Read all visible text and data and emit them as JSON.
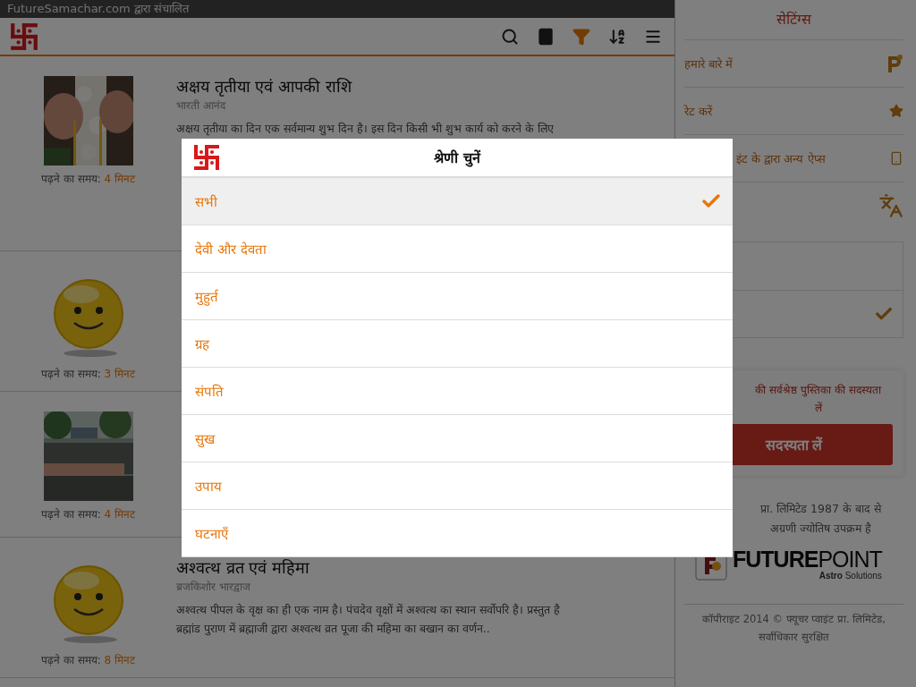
{
  "top_strip": {
    "text": "FutureSamachar.com द्वारा संचालित"
  },
  "toolbar": {
    "buttons": [
      {
        "kind": "search",
        "selected": false
      },
      {
        "kind": "book",
        "selected": false
      },
      {
        "kind": "filter",
        "selected": true
      },
      {
        "kind": "sort",
        "selected": false
      },
      {
        "kind": "menu",
        "selected": false
      }
    ]
  },
  "articles": [
    {
      "kind": "picture",
      "title": "अक्षय तृतीया एवं आपकी राशि",
      "author": "भारती आनंद",
      "body_lines": [
        "अक्षय तृतीया का दिन एक सर्वमान्य  शुभ दिन है। इस दिन किसी भी शुभ  कार्य को करने के लिए"
      ],
      "reading_label": "पढ़ने का समय:",
      "reading_time": "4 मिनट"
    },
    {
      "kind": "icon",
      "reading_label": "पढ़ने का समय:",
      "reading_time": "3 मिनट"
    },
    {
      "kind": "picture",
      "reading_label": "पढ़ने का समय:",
      "reading_time": "4 मिनट"
    },
    {
      "kind": "icon",
      "title": "अश्वत्थ व्रत एवं महिमा",
      "author": "ब्रजकिशोर भारद्वाज",
      "body_lines": [
        "अश्वत्थ पीपल के वृक्ष का ही एक नाम है। पंचदेव वृक्षों में अश्वत्थ का स्थान सर्वोपरि है। प्रस्तुत है",
        "ब्रह्मांड पुराण में ब्रह्माजी द्वारा अश्वत्थ व्रत पूजा की महिमा का बखान का वर्णन.."
      ],
      "reading_label": "पढ़ने का समय:",
      "reading_time": "8 मिनट"
    }
  ],
  "settings": {
    "title": "सेटिंग्स",
    "items": [
      {
        "kind": "about",
        "label": "हमारे बारे में"
      },
      {
        "kind": "rate",
        "label": "रेट करें"
      },
      {
        "kind": "apps",
        "label": "इंट के द्वारा अन्य ऐप्स"
      },
      {
        "kind": "language"
      }
    ],
    "options": [
      {
        "checked": false
      },
      {
        "checked": true
      }
    ],
    "promo": {
      "text_lines": [
        "की सर्वश्रेष्ठ पुस्तिका की सदस्यता",
        "लें"
      ],
      "button": "सदस्यता लें"
    },
    "about_lines": [
      "प्रा. लिमिटेड 1987 के बाद से",
      "अग्रणी ज्योतिष उपक्रम है"
    ],
    "brand": {
      "name": "**FUTURE**POINT",
      "tagline": "**Astro** Solutions"
    },
    "copyright_lines": [
      "कॉपीराइट 2014 © फ्यूचर प्वाइंट प्रा. लिमिटेड,",
      "सर्वाधिकार सुरक्षित"
    ]
  },
  "dialog": {
    "title": "श्रेणी चुनें",
    "options": [
      {
        "label": "सभी",
        "selected": true
      },
      {
        "label": "देवी और देवता",
        "selected": false
      },
      {
        "label": "मुहुर्त",
        "selected": false
      },
      {
        "label": "ग्रह",
        "selected": false
      },
      {
        "label": "संपति",
        "selected": false
      },
      {
        "label": "सुख",
        "selected": false
      },
      {
        "label": "उपाय",
        "selected": false
      },
      {
        "label": "घटनाएँ",
        "selected": false
      }
    ]
  }
}
